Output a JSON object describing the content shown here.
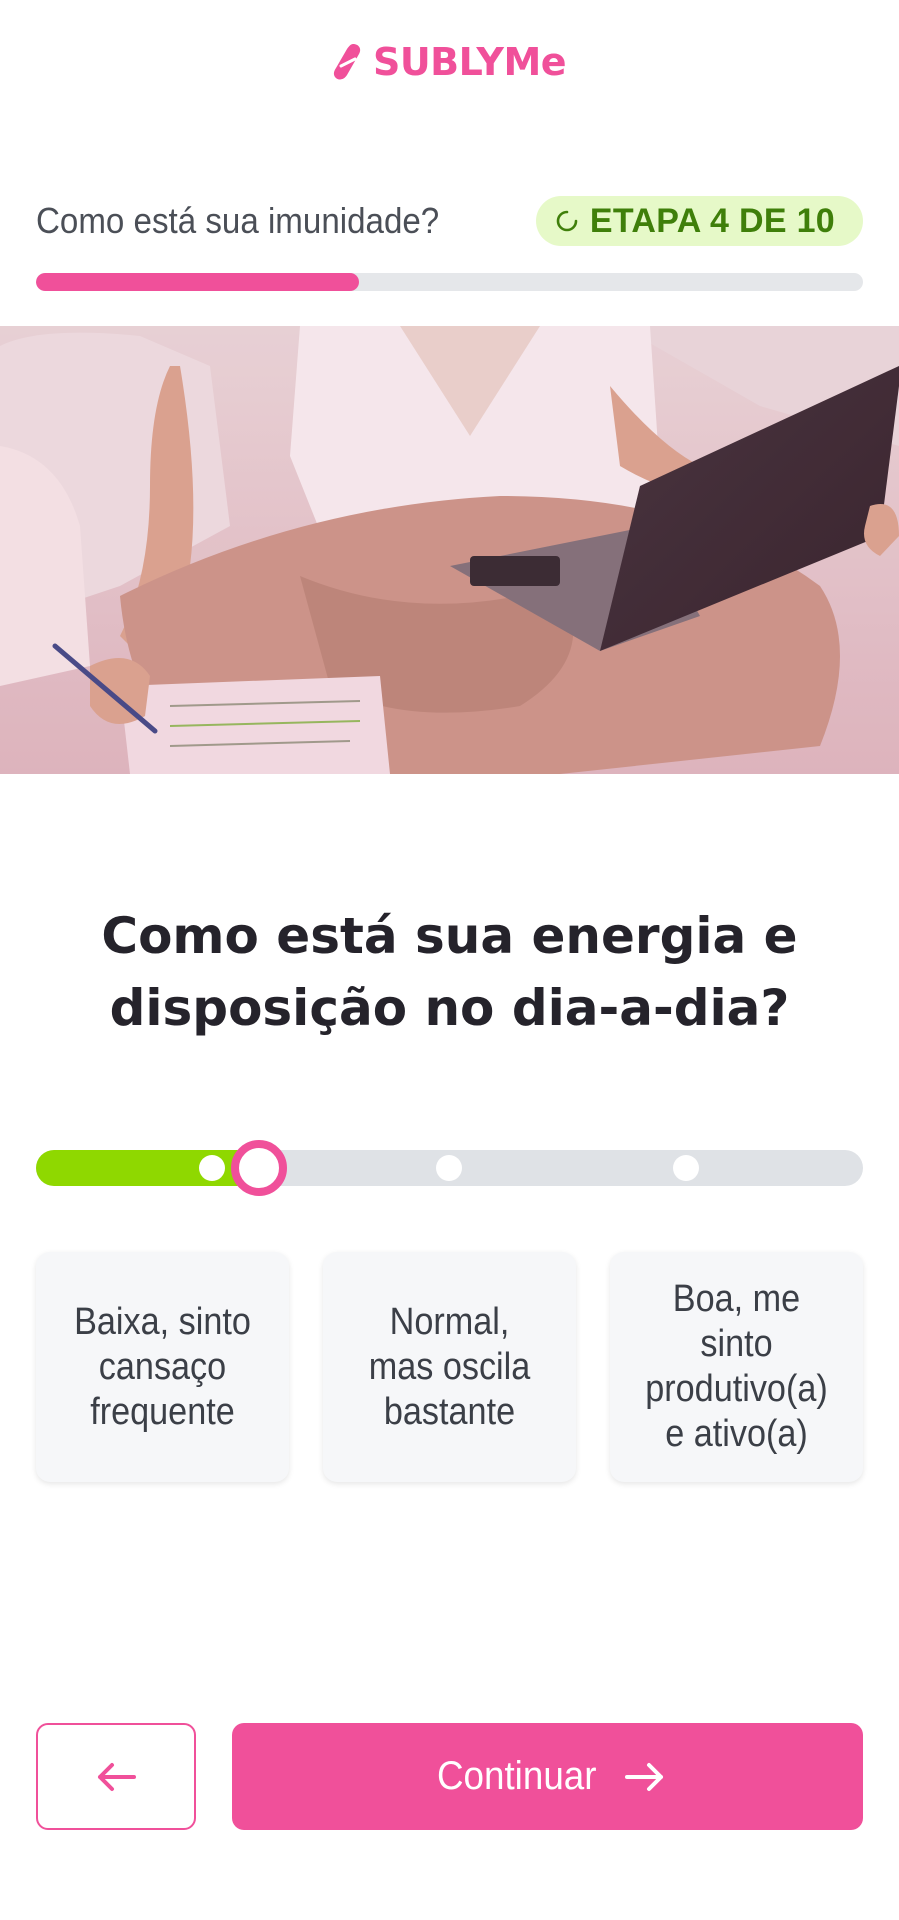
{
  "brand": {
    "name": "SUBLYMe",
    "color": "#f0509a"
  },
  "step": {
    "title": "Como está sua imunidade?",
    "badge": "ETAPA 4 DE 10",
    "current": 4,
    "total": 10,
    "progress_percent": 39,
    "badge_icon": "loading-spinner-icon"
  },
  "hero": {
    "image": "woman-on-sofa-with-laptop-and-notebook"
  },
  "question": {
    "text": "Como está sua energia e disposição no dia-a-dia?"
  },
  "slider": {
    "value_fraction": 0.27,
    "stops": 4,
    "fill_color": "#8fd800",
    "thumb_color": "#f0509a"
  },
  "options": [
    {
      "label": "Baixa, sinto cansaço frequente"
    },
    {
      "label": "Normal, mas oscila bastante"
    },
    {
      "label": "Boa, me sinto produtivo(a) e ativo(a)"
    }
  ],
  "nav": {
    "back_icon": "arrow-left-icon",
    "continue_label": "Continuar",
    "continue_icon": "arrow-right-icon"
  }
}
